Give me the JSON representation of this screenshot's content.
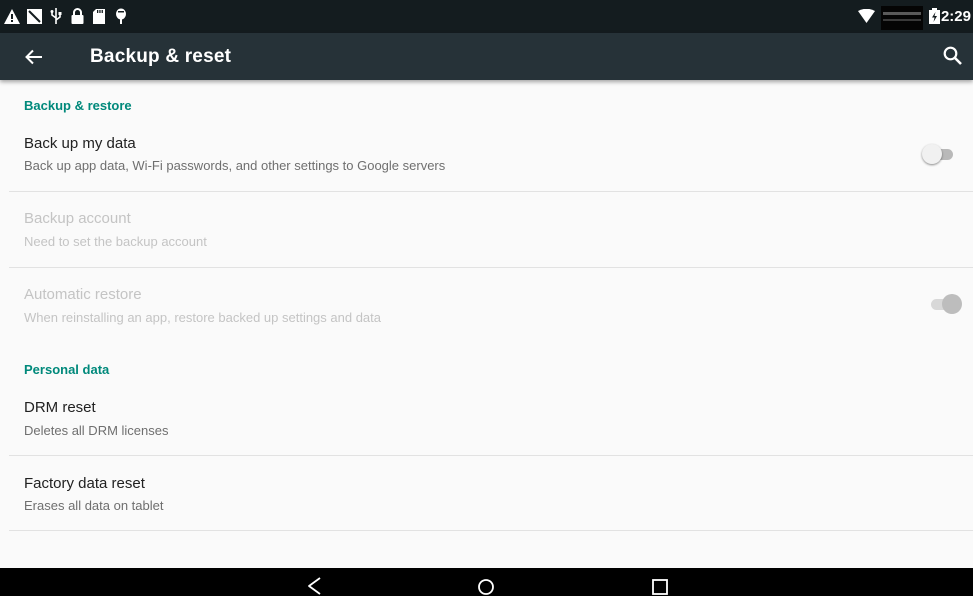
{
  "status_bar": {
    "left_icons": [
      "warning-icon",
      "no-sim-icon",
      "usb-icon",
      "lock-icon",
      "sd-card-icon",
      "bug-icon"
    ],
    "right_icons": [
      "wifi-icon",
      "battery-charging-icon"
    ],
    "time": "2:29"
  },
  "app_bar": {
    "back_icon": "arrow-back-icon",
    "title": "Backup & reset",
    "search_icon": "search-icon"
  },
  "sections": {
    "backup_restore": {
      "header": "Backup & restore",
      "items": [
        {
          "title": "Back up my data",
          "summary": "Back up app data, Wi-Fi passwords, and other settings to Google servers",
          "switch": "off",
          "enabled": true
        },
        {
          "title": "Backup account",
          "summary": "Need to set the backup account",
          "enabled": false
        },
        {
          "title": "Automatic restore",
          "summary": "When reinstalling an app, restore backed up settings and data",
          "switch": "on",
          "enabled": false
        }
      ]
    },
    "personal_data": {
      "header": "Personal data",
      "items": [
        {
          "title": "DRM reset",
          "summary": "Deletes all DRM licenses"
        },
        {
          "title": "Factory data reset",
          "summary": "Erases all data on tablet"
        }
      ]
    }
  },
  "nav_bar": {
    "buttons": [
      "nav-back-icon",
      "nav-home-icon",
      "nav-recents-icon"
    ]
  },
  "colors": {
    "accent": "#00897b",
    "app_bar": "#263238",
    "status_bar": "#141c1f",
    "background": "#fafafa"
  }
}
